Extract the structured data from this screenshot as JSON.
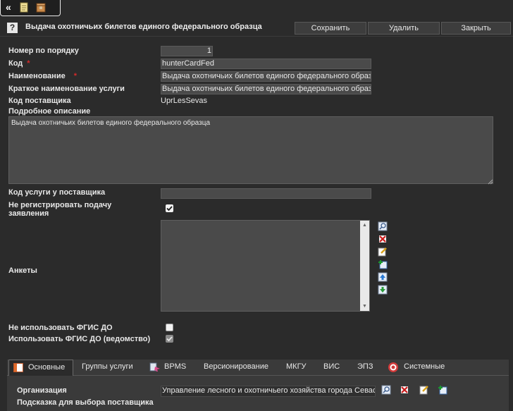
{
  "toolbar": {
    "collapse_label": "«"
  },
  "header": {
    "help_glyph": "?",
    "title": "Выдача охотничьих билетов единого федерального образца",
    "save_label": "Сохранить",
    "delete_label": "Удалить",
    "close_label": "Закрыть"
  },
  "form": {
    "order_label": "Номер по порядку",
    "order_value": "1",
    "code_label": "Код",
    "code_required": "*",
    "code_value": "hunterCardFed",
    "name_label": "Наименование",
    "name_required": "*",
    "name_value": "Выдача охотничьих билетов единого федерального образца",
    "short_name_label": "Краткое наименование услуги",
    "short_name_value": "Выдача охотничьих билетов единого федерального образца",
    "supplier_code_label": "Код поставщика",
    "supplier_code_value": "UprLesSevas",
    "description_label": "Подробное описание",
    "description_value": "Выдача охотничьих билетов единого федерального образца",
    "supplier_service_code_label": "Код услуги у поставщика",
    "supplier_service_code_value": "",
    "no_register_label_1": "Не регистрировать подачу",
    "no_register_label_2": "заявления",
    "no_register_checked": true,
    "forms_label": "Анкеты",
    "no_fgis_label": "Не использовать ФГИС ДО",
    "no_fgis_checked": false,
    "use_fgis_label": "Использовать ФГИС ДО (ведомство)",
    "use_fgis_checked": true
  },
  "tabs": [
    {
      "label": "Основные",
      "icon": "layout-icon",
      "active": true
    },
    {
      "label": "Группы услуги"
    },
    {
      "label": "BPMS",
      "icon": "bpms-icon"
    },
    {
      "label": "Версионирование"
    },
    {
      "label": "МКГУ"
    },
    {
      "label": "ВИС"
    },
    {
      "label": "ЭПЗ"
    },
    {
      "label": "Системные",
      "icon": "system-icon"
    }
  ],
  "panel": {
    "organization_label": "Организация",
    "organization_value": "Управление лесного и охотничьего хозяйства города Севастополя",
    "supplier_hint_label": "Подсказка для выбора поставщика"
  },
  "colors": {
    "background": "#2b2b2b",
    "field": "#4a4a4a",
    "required": "#d42a2a"
  }
}
